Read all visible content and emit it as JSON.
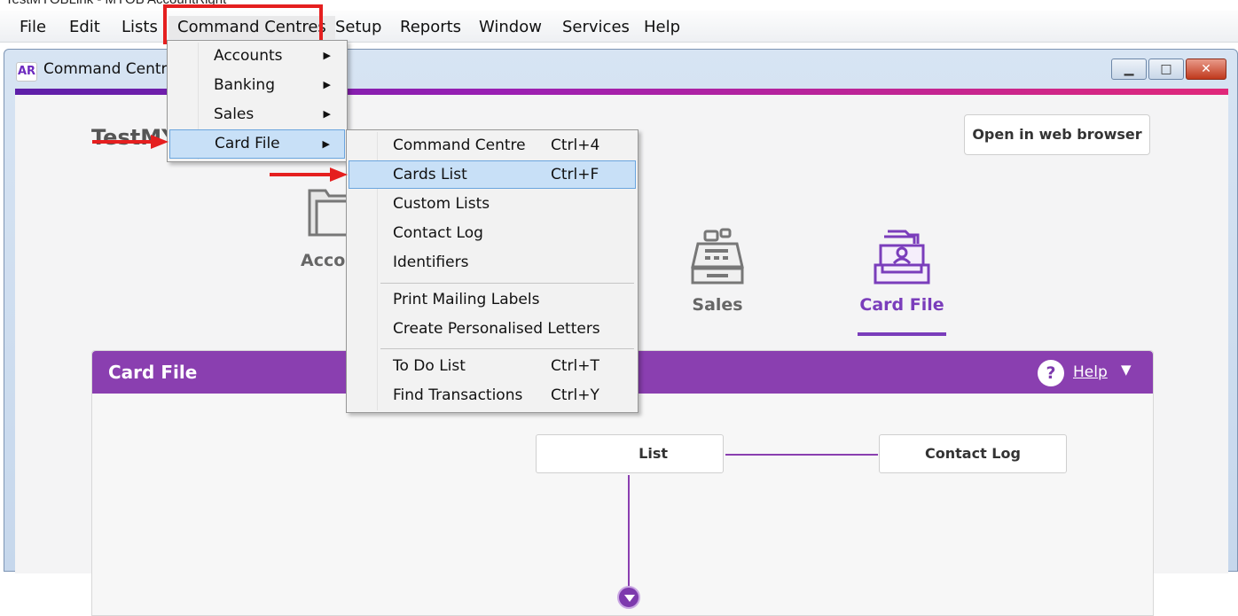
{
  "os_title": "TestMYOBLink - MYOB AccountRight",
  "menubar": {
    "items": [
      "File",
      "Edit",
      "Lists",
      "Command Centres",
      "Setup",
      "Reports",
      "Window",
      "Services",
      "Help"
    ]
  },
  "window": {
    "logo": "AR",
    "title": "Command Centre",
    "buttons": {
      "minimize": "▁",
      "maximize": "□",
      "close": "✕"
    }
  },
  "company": "TestMY",
  "open_web_label": "Open in web browser",
  "nav": {
    "accounts_label": "Accou",
    "sales_label": "Sales",
    "cardfile_label": "Card File",
    "active": "Card File"
  },
  "panel": {
    "title": "Card File",
    "help_label": "Help",
    "help_glyph": "?",
    "help_chevron": "▼"
  },
  "flow": {
    "cards_list_label": "List",
    "contact_log_label": "Contact Log"
  },
  "menu_command_centres": {
    "items": [
      {
        "label": "Accounts",
        "submenu": true
      },
      {
        "label": "Banking",
        "submenu": true
      },
      {
        "label": "Sales",
        "submenu": true
      },
      {
        "label": "Card File",
        "submenu": true,
        "selected": true
      }
    ],
    "arrow_glyph": "▶"
  },
  "menu_card_file": {
    "groups": [
      [
        {
          "label": "Command Centre",
          "shortcut": "Ctrl+4"
        },
        {
          "label": "Cards List",
          "shortcut": "Ctrl+F",
          "selected": true
        },
        {
          "label": "Custom Lists",
          "shortcut": ""
        },
        {
          "label": "Contact Log",
          "shortcut": ""
        },
        {
          "label": "Identifiers",
          "shortcut": ""
        }
      ],
      [
        {
          "label": "Print Mailing Labels",
          "shortcut": ""
        },
        {
          "label": "Create Personalised Letters",
          "shortcut": ""
        }
      ],
      [
        {
          "label": "To Do List",
          "shortcut": "Ctrl+T"
        },
        {
          "label": "Find Transactions",
          "shortcut": "Ctrl+Y"
        }
      ]
    ]
  },
  "colors": {
    "accent_purple": "#8a3fb0",
    "highlight_red": "#e51f1f",
    "menu_selection": "#c8e0f7"
  }
}
